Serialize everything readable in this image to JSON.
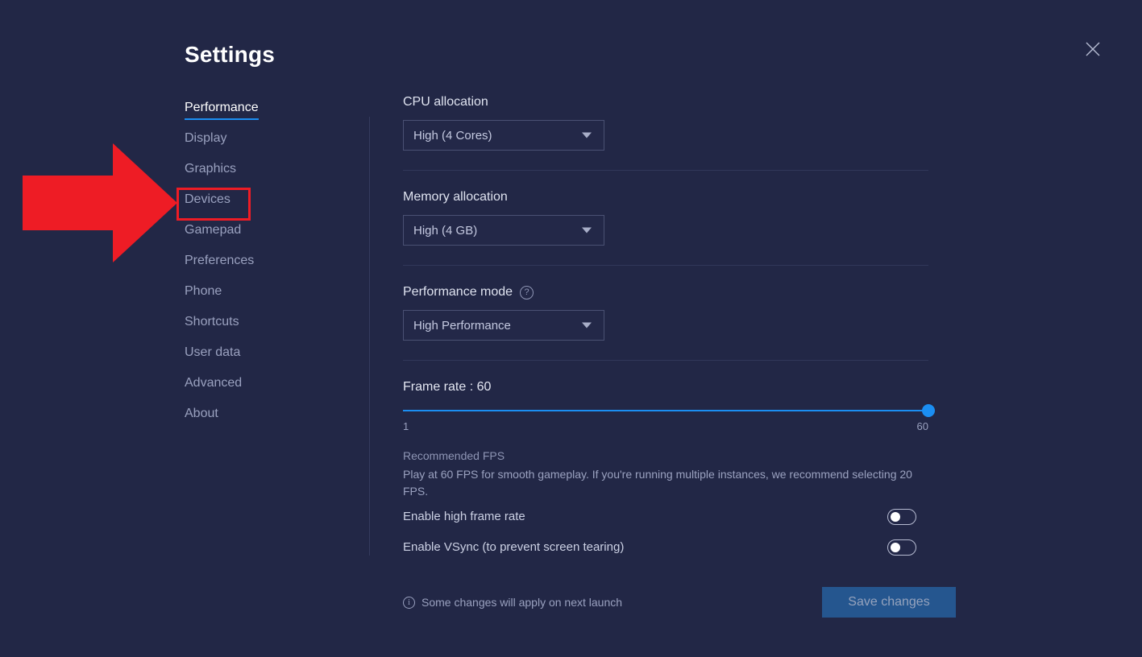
{
  "header": {
    "title": "Settings",
    "close_icon": "close-icon"
  },
  "sidebar": {
    "items": [
      {
        "label": "Performance",
        "active": true
      },
      {
        "label": "Display",
        "active": false
      },
      {
        "label": "Graphics",
        "active": false
      },
      {
        "label": "Devices",
        "active": false
      },
      {
        "label": "Gamepad",
        "active": false
      },
      {
        "label": "Preferences",
        "active": false
      },
      {
        "label": "Phone",
        "active": false
      },
      {
        "label": "Shortcuts",
        "active": false
      },
      {
        "label": "User data",
        "active": false
      },
      {
        "label": "Advanced",
        "active": false
      },
      {
        "label": "About",
        "active": false
      }
    ]
  },
  "content": {
    "cpu": {
      "label": "CPU allocation",
      "value": "High (4 Cores)"
    },
    "memory": {
      "label": "Memory allocation",
      "value": "High (4 GB)"
    },
    "performance_mode": {
      "label": "Performance mode",
      "help_icon": "help-circle-icon",
      "value": "High Performance"
    },
    "frame_rate": {
      "label": "Frame rate : 60",
      "value": 60,
      "min": 1,
      "max": 60,
      "min_label": "1",
      "max_label": "60"
    },
    "hint": {
      "title": "Recommended FPS",
      "body": "Play at 60 FPS for smooth gameplay. If you're running multiple instances, we recommend selecting 20 FPS."
    },
    "toggles": [
      {
        "label": "Enable high frame rate",
        "on": false
      },
      {
        "label": "Enable VSync (to prevent screen tearing)",
        "on": false
      }
    ]
  },
  "footer": {
    "note": "Some changes will apply on next launch",
    "info_icon": "info-circle-icon",
    "save_label": "Save changes"
  },
  "annotation": {
    "arrow_icon": "red-arrow-right",
    "highlight_target": "Devices",
    "accent_color": "#ee1c25"
  },
  "colors": {
    "background": "#222746",
    "accent": "#1b8ef2",
    "button": "#25568f",
    "annotation": "#ee1c25"
  }
}
